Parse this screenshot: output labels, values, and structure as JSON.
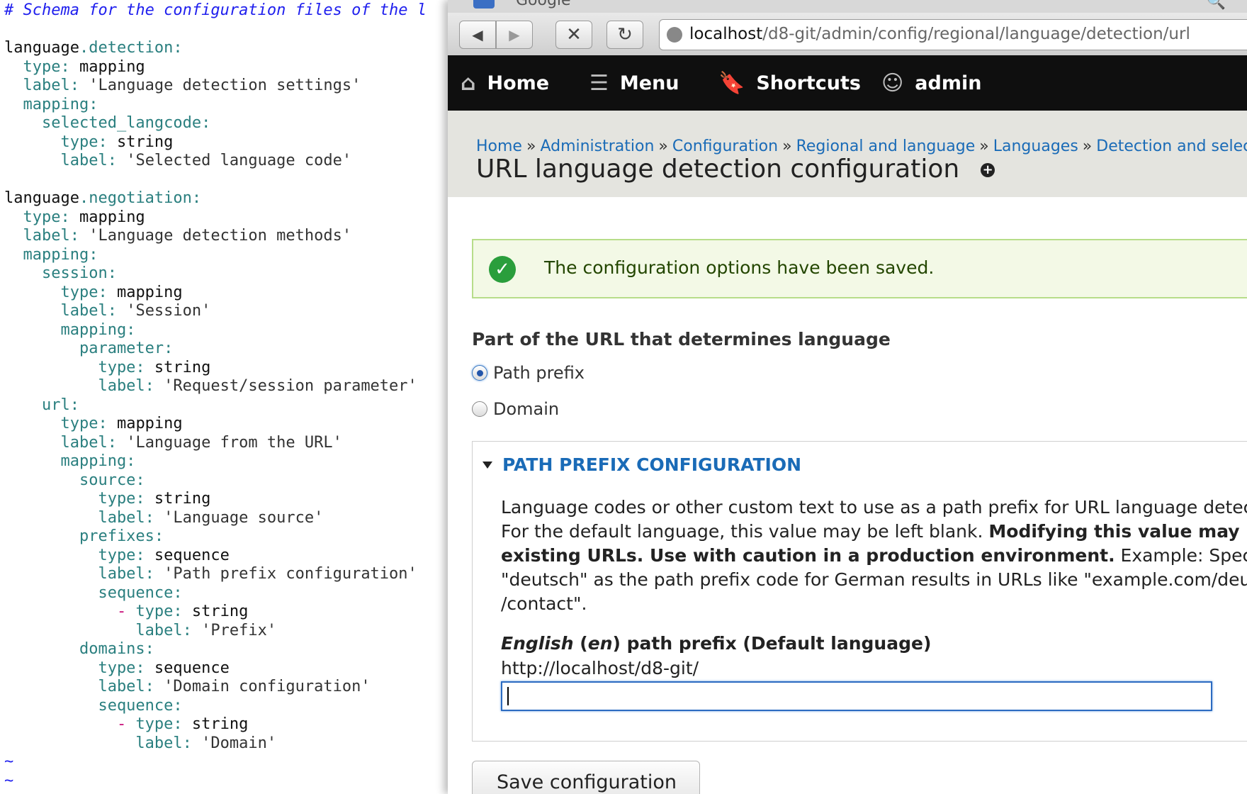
{
  "editor": {
    "lines": [
      [
        {
          "t": "# Schema for the configuration files of the l",
          "c": "comment"
        }
      ],
      [],
      [
        {
          "t": "language",
          "c": "root"
        },
        {
          "t": ".detection:",
          "c": "key"
        }
      ],
      [
        {
          "t": "  type:",
          "c": "key"
        },
        {
          "t": " mapping",
          "c": "val"
        }
      ],
      [
        {
          "t": "  label:",
          "c": "key"
        },
        {
          "t": " 'Language detection settings'",
          "c": "str"
        }
      ],
      [
        {
          "t": "  mapping:",
          "c": "key"
        }
      ],
      [
        {
          "t": "    selected_langcode:",
          "c": "key"
        }
      ],
      [
        {
          "t": "      type:",
          "c": "key"
        },
        {
          "t": " string",
          "c": "val"
        }
      ],
      [
        {
          "t": "      label:",
          "c": "key"
        },
        {
          "t": " 'Selected language code'",
          "c": "str"
        }
      ],
      [],
      [
        {
          "t": "language",
          "c": "root"
        },
        {
          "t": ".negotiation:",
          "c": "key"
        }
      ],
      [
        {
          "t": "  type:",
          "c": "key"
        },
        {
          "t": " mapping",
          "c": "val"
        }
      ],
      [
        {
          "t": "  label:",
          "c": "key"
        },
        {
          "t": " 'Language detection methods'",
          "c": "str"
        }
      ],
      [
        {
          "t": "  mapping:",
          "c": "key"
        }
      ],
      [
        {
          "t": "    session:",
          "c": "key"
        }
      ],
      [
        {
          "t": "      type:",
          "c": "key"
        },
        {
          "t": " mapping",
          "c": "val"
        }
      ],
      [
        {
          "t": "      label:",
          "c": "key"
        },
        {
          "t": " 'Session'",
          "c": "str"
        }
      ],
      [
        {
          "t": "      mapping:",
          "c": "key"
        }
      ],
      [
        {
          "t": "        parameter:",
          "c": "key"
        }
      ],
      [
        {
          "t": "          type:",
          "c": "key"
        },
        {
          "t": " string",
          "c": "val"
        }
      ],
      [
        {
          "t": "          label:",
          "c": "key"
        },
        {
          "t": " 'Request/session parameter'",
          "c": "str"
        }
      ],
      [
        {
          "t": "    url:",
          "c": "key"
        }
      ],
      [
        {
          "t": "      type:",
          "c": "key"
        },
        {
          "t": " mapping",
          "c": "val"
        }
      ],
      [
        {
          "t": "      label:",
          "c": "key"
        },
        {
          "t": " 'Language from the URL'",
          "c": "str"
        }
      ],
      [
        {
          "t": "      mapping:",
          "c": "key"
        }
      ],
      [
        {
          "t": "        source:",
          "c": "key"
        }
      ],
      [
        {
          "t": "          type:",
          "c": "key"
        },
        {
          "t": " string",
          "c": "val"
        }
      ],
      [
        {
          "t": "          label:",
          "c": "key"
        },
        {
          "t": " 'Language source'",
          "c": "str"
        }
      ],
      [
        {
          "t": "        prefixes:",
          "c": "key"
        }
      ],
      [
        {
          "t": "          type:",
          "c": "key"
        },
        {
          "t": " sequence",
          "c": "val"
        }
      ],
      [
        {
          "t": "          label:",
          "c": "key"
        },
        {
          "t": " 'Path prefix configuration'",
          "c": "str"
        }
      ],
      [
        {
          "t": "          sequence:",
          "c": "key"
        }
      ],
      [
        {
          "t": "            - ",
          "c": "dash"
        },
        {
          "t": "type:",
          "c": "key"
        },
        {
          "t": " string",
          "c": "val"
        }
      ],
      [
        {
          "t": "              label:",
          "c": "key"
        },
        {
          "t": " 'Prefix'",
          "c": "str"
        }
      ],
      [
        {
          "t": "        domains:",
          "c": "key"
        }
      ],
      [
        {
          "t": "          type:",
          "c": "key"
        },
        {
          "t": " sequence",
          "c": "val"
        }
      ],
      [
        {
          "t": "          label:",
          "c": "key"
        },
        {
          "t": " 'Domain configuration'",
          "c": "str"
        }
      ],
      [
        {
          "t": "          sequence:",
          "c": "key"
        }
      ],
      [
        {
          "t": "            - ",
          "c": "dash"
        },
        {
          "t": "type:",
          "c": "key"
        },
        {
          "t": " string",
          "c": "val"
        }
      ],
      [
        {
          "t": "              label:",
          "c": "key"
        },
        {
          "t": " 'Domain'",
          "c": "str"
        }
      ],
      [
        {
          "t": "~",
          "c": "tilde"
        }
      ],
      [
        {
          "t": "~",
          "c": "tilde"
        }
      ],
      [
        {
          "t": "~",
          "c": "tilde"
        }
      ]
    ]
  },
  "browser": {
    "tab_title": "Google",
    "url_host": "localhost",
    "url_path": "/d8-git/admin/config/regional/language/detection/url",
    "icons": {
      "back": "arrow-left-icon",
      "forward": "arrow-right-icon",
      "stop": "close-icon",
      "reload": "reload-icon",
      "globe": "globe-icon"
    }
  },
  "adminbar": {
    "home": "Home",
    "menu": "Menu",
    "shortcuts": "Shortcuts",
    "user": "admin"
  },
  "breadcrumb": [
    "Home",
    "Administration",
    "Configuration",
    "Regional and language",
    "Languages",
    "Detection and selection"
  ],
  "breadcrumb_sep": "»",
  "page_title": "URL language detection configuration",
  "status_message": "The configuration options have been saved.",
  "form": {
    "part_label": "Part of the URL that determines language",
    "radio_path": "Path prefix",
    "radio_domain": "Domain",
    "selected": "Path prefix",
    "fieldset_legend": "PATH PREFIX CONFIGURATION",
    "description_lines": [
      [
        {
          "t": "Language codes or other custom text to use as a path prefix for URL language detection.",
          "b": false
        }
      ],
      [
        {
          "t": "For the default language, this value may be left blank. ",
          "b": false
        },
        {
          "t": "Modifying this value may break",
          "b": true
        }
      ],
      [
        {
          "t": "existing URLs. Use with caution in a production environment.",
          "b": true
        },
        {
          "t": " Example: Specifying",
          "b": false
        }
      ],
      [
        {
          "t": "\"deutsch\" as the path prefix code for German results in URLs like \"example.com/deutsch",
          "b": false
        }
      ],
      [
        {
          "t": "/contact\".",
          "b": false
        }
      ]
    ],
    "prefix_label_lang": "English",
    "prefix_label_code": "en",
    "prefix_label_rest": " path prefix (Default language)",
    "field_prefix": "http://localhost/d8-git/",
    "prefix_value": ""
  },
  "save_button": "Save configuration",
  "colors": {
    "link": "#1a6bb7",
    "adminbar": "#0f0f0f",
    "status_bg": "#f3f9e6",
    "status_border": "#b7dd8a"
  }
}
